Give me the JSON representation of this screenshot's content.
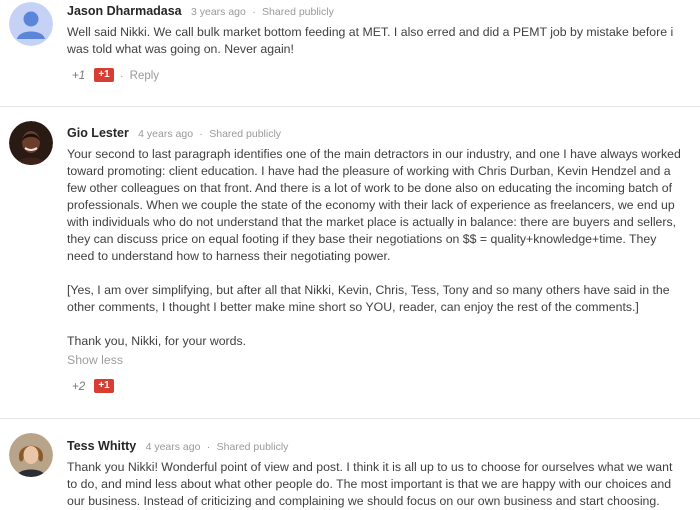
{
  "comments": [
    {
      "author": "Jason Dharmadasa",
      "time": "3 years ago",
      "shared": "Shared publicly",
      "paragraphs": [
        "Well said Nikki. We call bulk market bottom feeding at MET. I also erred and did a PEMT job by mistake before i was told what was going on. Never again!"
      ],
      "plus_count": "+1",
      "plus_label": "+1",
      "reply_label": "Reply",
      "avatar_icon": "default-person-avatar"
    },
    {
      "author": "Gio Lester",
      "time": "4 years ago",
      "shared": "Shared publicly",
      "paragraphs": [
        "Your second to last paragraph identifies one of the main detractors in our industry, and one I have always worked toward promoting: client education. I have had the pleasure of working with Chris Durban, Kevin Hendzel and a few other colleagues on that front. And there is a lot of work to be done also on educating the incoming batch of professionals. When we couple the state of the economy with their lack of experience as freelancers, we end up with individuals who do not understand that the market place is actually in balance: there are buyers and sellers, they can discuss price on equal footing if they base their  negotiations on $$ = quality+knowledge+time. They need to understand how to harness their negotiating power.",
        "[Yes, I am over simplifying, but after all that Nikki, Kevin, Chris, Tess, Tony and so many others have said in the other comments, I thought I better make mine short so YOU, reader, can enjoy the rest of the comments.]",
        "Thank you, Nikki, for your words."
      ],
      "show_less": "Show less",
      "plus_count": "+2",
      "plus_label": "+1",
      "avatar_icon": "user-photo-avatar"
    },
    {
      "author": "Tess Whitty",
      "time": "4 years ago",
      "shared": "Shared publicly",
      "paragraphs": [
        "Thank you Nikki! Wonderful point of view and post. I think it is all up to us to choose for ourselves what we want to do, and mind less about what other people do. The most important is that we are happy with our choices and our business. Instead of criticizing and complaining we should focus on our own business and start choosing."
      ],
      "avatar_icon": "user-photo-avatar"
    }
  ],
  "separator": "·"
}
